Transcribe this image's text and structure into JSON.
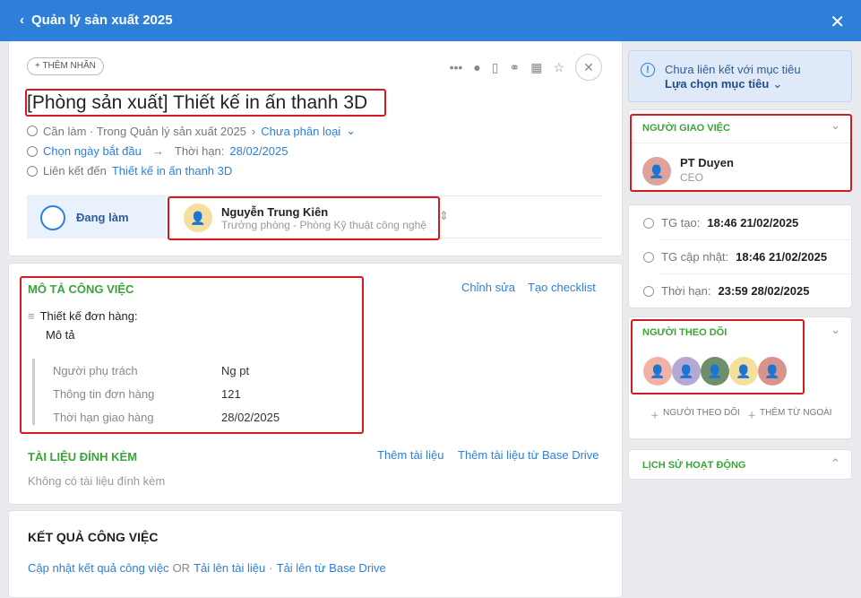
{
  "topbar": {
    "back_label": "Quản lý sản xuất 2025"
  },
  "task": {
    "tag_button": "+ THÊM NHÃN",
    "title": "[Phòng sản xuất] Thiết kế in ấn thanh 3D",
    "status_path": "Cần làm · Trong Quản lý sản xuất 2025",
    "category": "Chưa phân loại",
    "start_date": "Chọn ngày bắt đầu",
    "deadline_label": "Thời hạn:",
    "deadline": "28/02/2025",
    "link_label": "Liên kết đến",
    "link_target": "Thiết kế in ấn thanh 3D",
    "status": "Đang làm",
    "assignee_name": "Nguyễn Trung Kiên",
    "assignee_role": "Trưởng phòng - Phòng Kỹ thuật công nghệ"
  },
  "description": {
    "heading": "MÔ TẢ CÔNG VIỆC",
    "edit": "Chỉnh sửa",
    "checklist": "Tạo checklist",
    "form_name": "Thiết kế đơn hàng:",
    "desc_label": "Mô tả",
    "fields": [
      {
        "label": "Người phụ trách",
        "value": "Ng pt"
      },
      {
        "label": "Thông tin đơn hàng",
        "value": "121"
      },
      {
        "label": "Thời hạn giao hàng",
        "value": "28/02/2025"
      }
    ]
  },
  "attachments": {
    "heading": "TÀI LIỆU ĐÍNH KÈM",
    "add": "Thêm tài liệu",
    "add_drive": "Thêm tài liệu từ Base Drive",
    "empty": "Không có tài liệu đính kèm"
  },
  "results": {
    "heading": "KẾT QUẢ CÔNG VIỆC",
    "update": "Cập nhật kết quả công việc",
    "or": "OR",
    "upload": "Tải lên tài liệu",
    "sep": "·",
    "upload_drive": "Tải lên từ Base Drive"
  },
  "goal": {
    "text": "Chưa liên kết với mục tiêu",
    "select": "Lựa chọn mục tiêu"
  },
  "assigner": {
    "heading": "NGƯỜI GIAO VIỆC",
    "name": "PT Duyen",
    "role": "CEO"
  },
  "times": {
    "created_label": "TG tạo:",
    "created": "18:46 21/02/2025",
    "updated_label": "TG cập nhật:",
    "updated": "18:46 21/02/2025",
    "deadline_label": "Thời hạn:",
    "deadline": "23:59 28/02/2025"
  },
  "followers": {
    "heading": "NGƯỜI THEO DÕI",
    "add_follower": "NGƯỜI THEO DÕI",
    "add_external": "THÊM TỪ NGOÀI"
  },
  "history": {
    "heading": "LỊCH SỬ HOẠT ĐỘNG"
  }
}
